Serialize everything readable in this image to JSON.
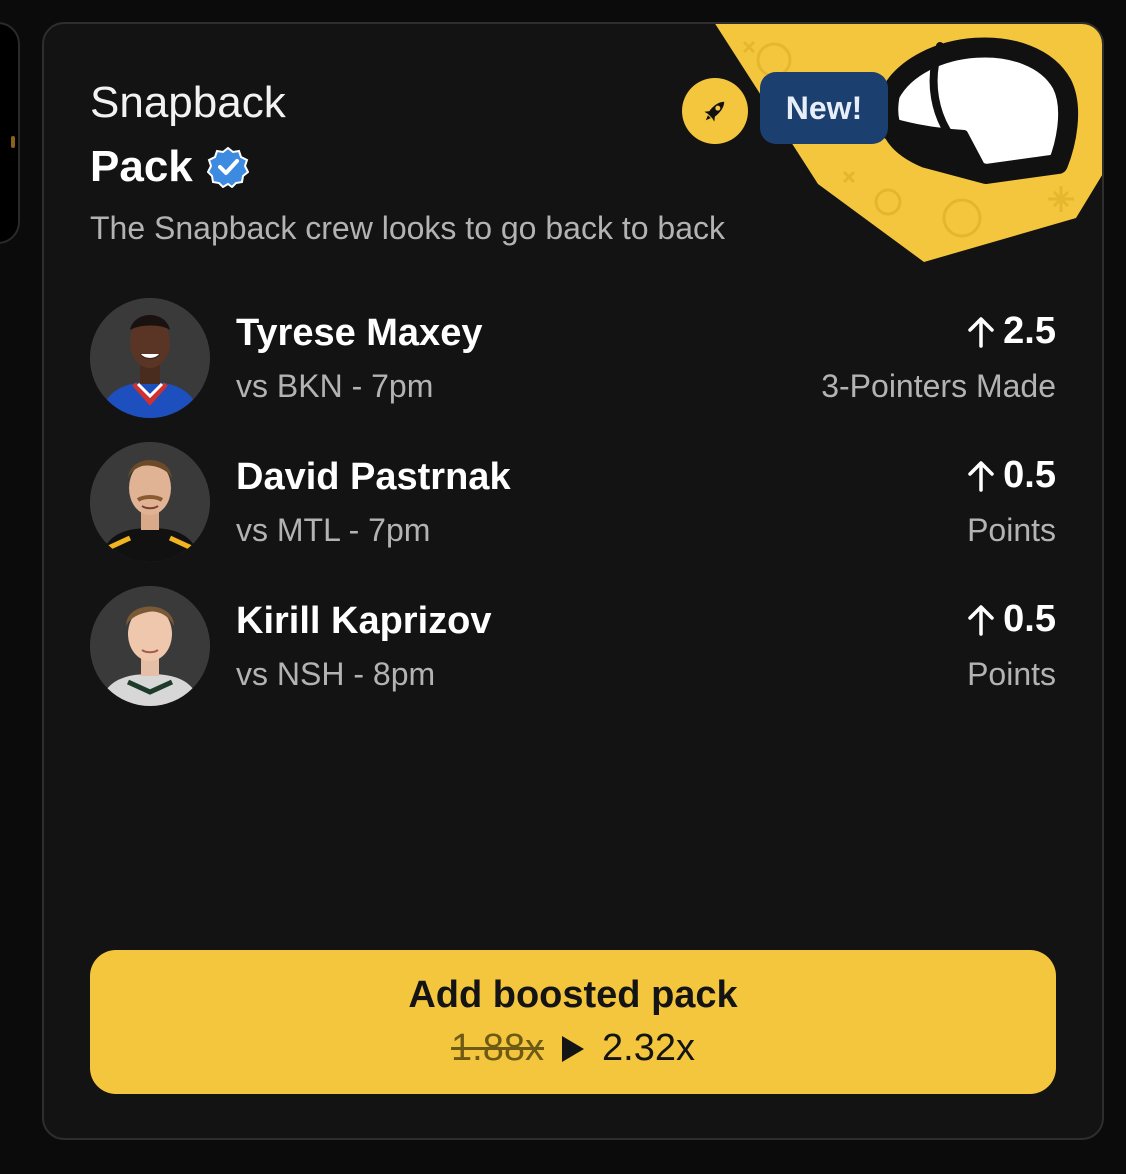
{
  "card": {
    "title_line1": "Snapback",
    "title_line2": "Pack",
    "description": "The Snapback crew looks to go back to back",
    "badge_new": "New!",
    "icons": {
      "verified": "verified-badge-icon",
      "rocket": "rocket-icon",
      "art": "snapback-cap-illustration"
    }
  },
  "players": [
    {
      "name": "Tyrese Maxey",
      "game": "vs BKN - 7pm",
      "line": "2.5",
      "direction": "over",
      "stat": "3-Pointers Made",
      "jersey_color": "#1d4fbf"
    },
    {
      "name": "David Pastrnak",
      "game": "vs MTL - 7pm",
      "line": "0.5",
      "direction": "over",
      "stat": "Points",
      "jersey_color": "#111111"
    },
    {
      "name": "Kirill Kaprizov",
      "game": "vs NSH - 8pm",
      "line": "0.5",
      "direction": "over",
      "stat": "Points",
      "jersey_color": "#d7d7d7"
    }
  ],
  "cta": {
    "label": "Add boosted pack",
    "old_odds": "1.88x",
    "new_odds": "2.32x"
  },
  "colors": {
    "accent": "#f4c63d",
    "card_bg": "#131313",
    "badge_bg": "#1b3f6f",
    "verified": "#3d8be0"
  }
}
